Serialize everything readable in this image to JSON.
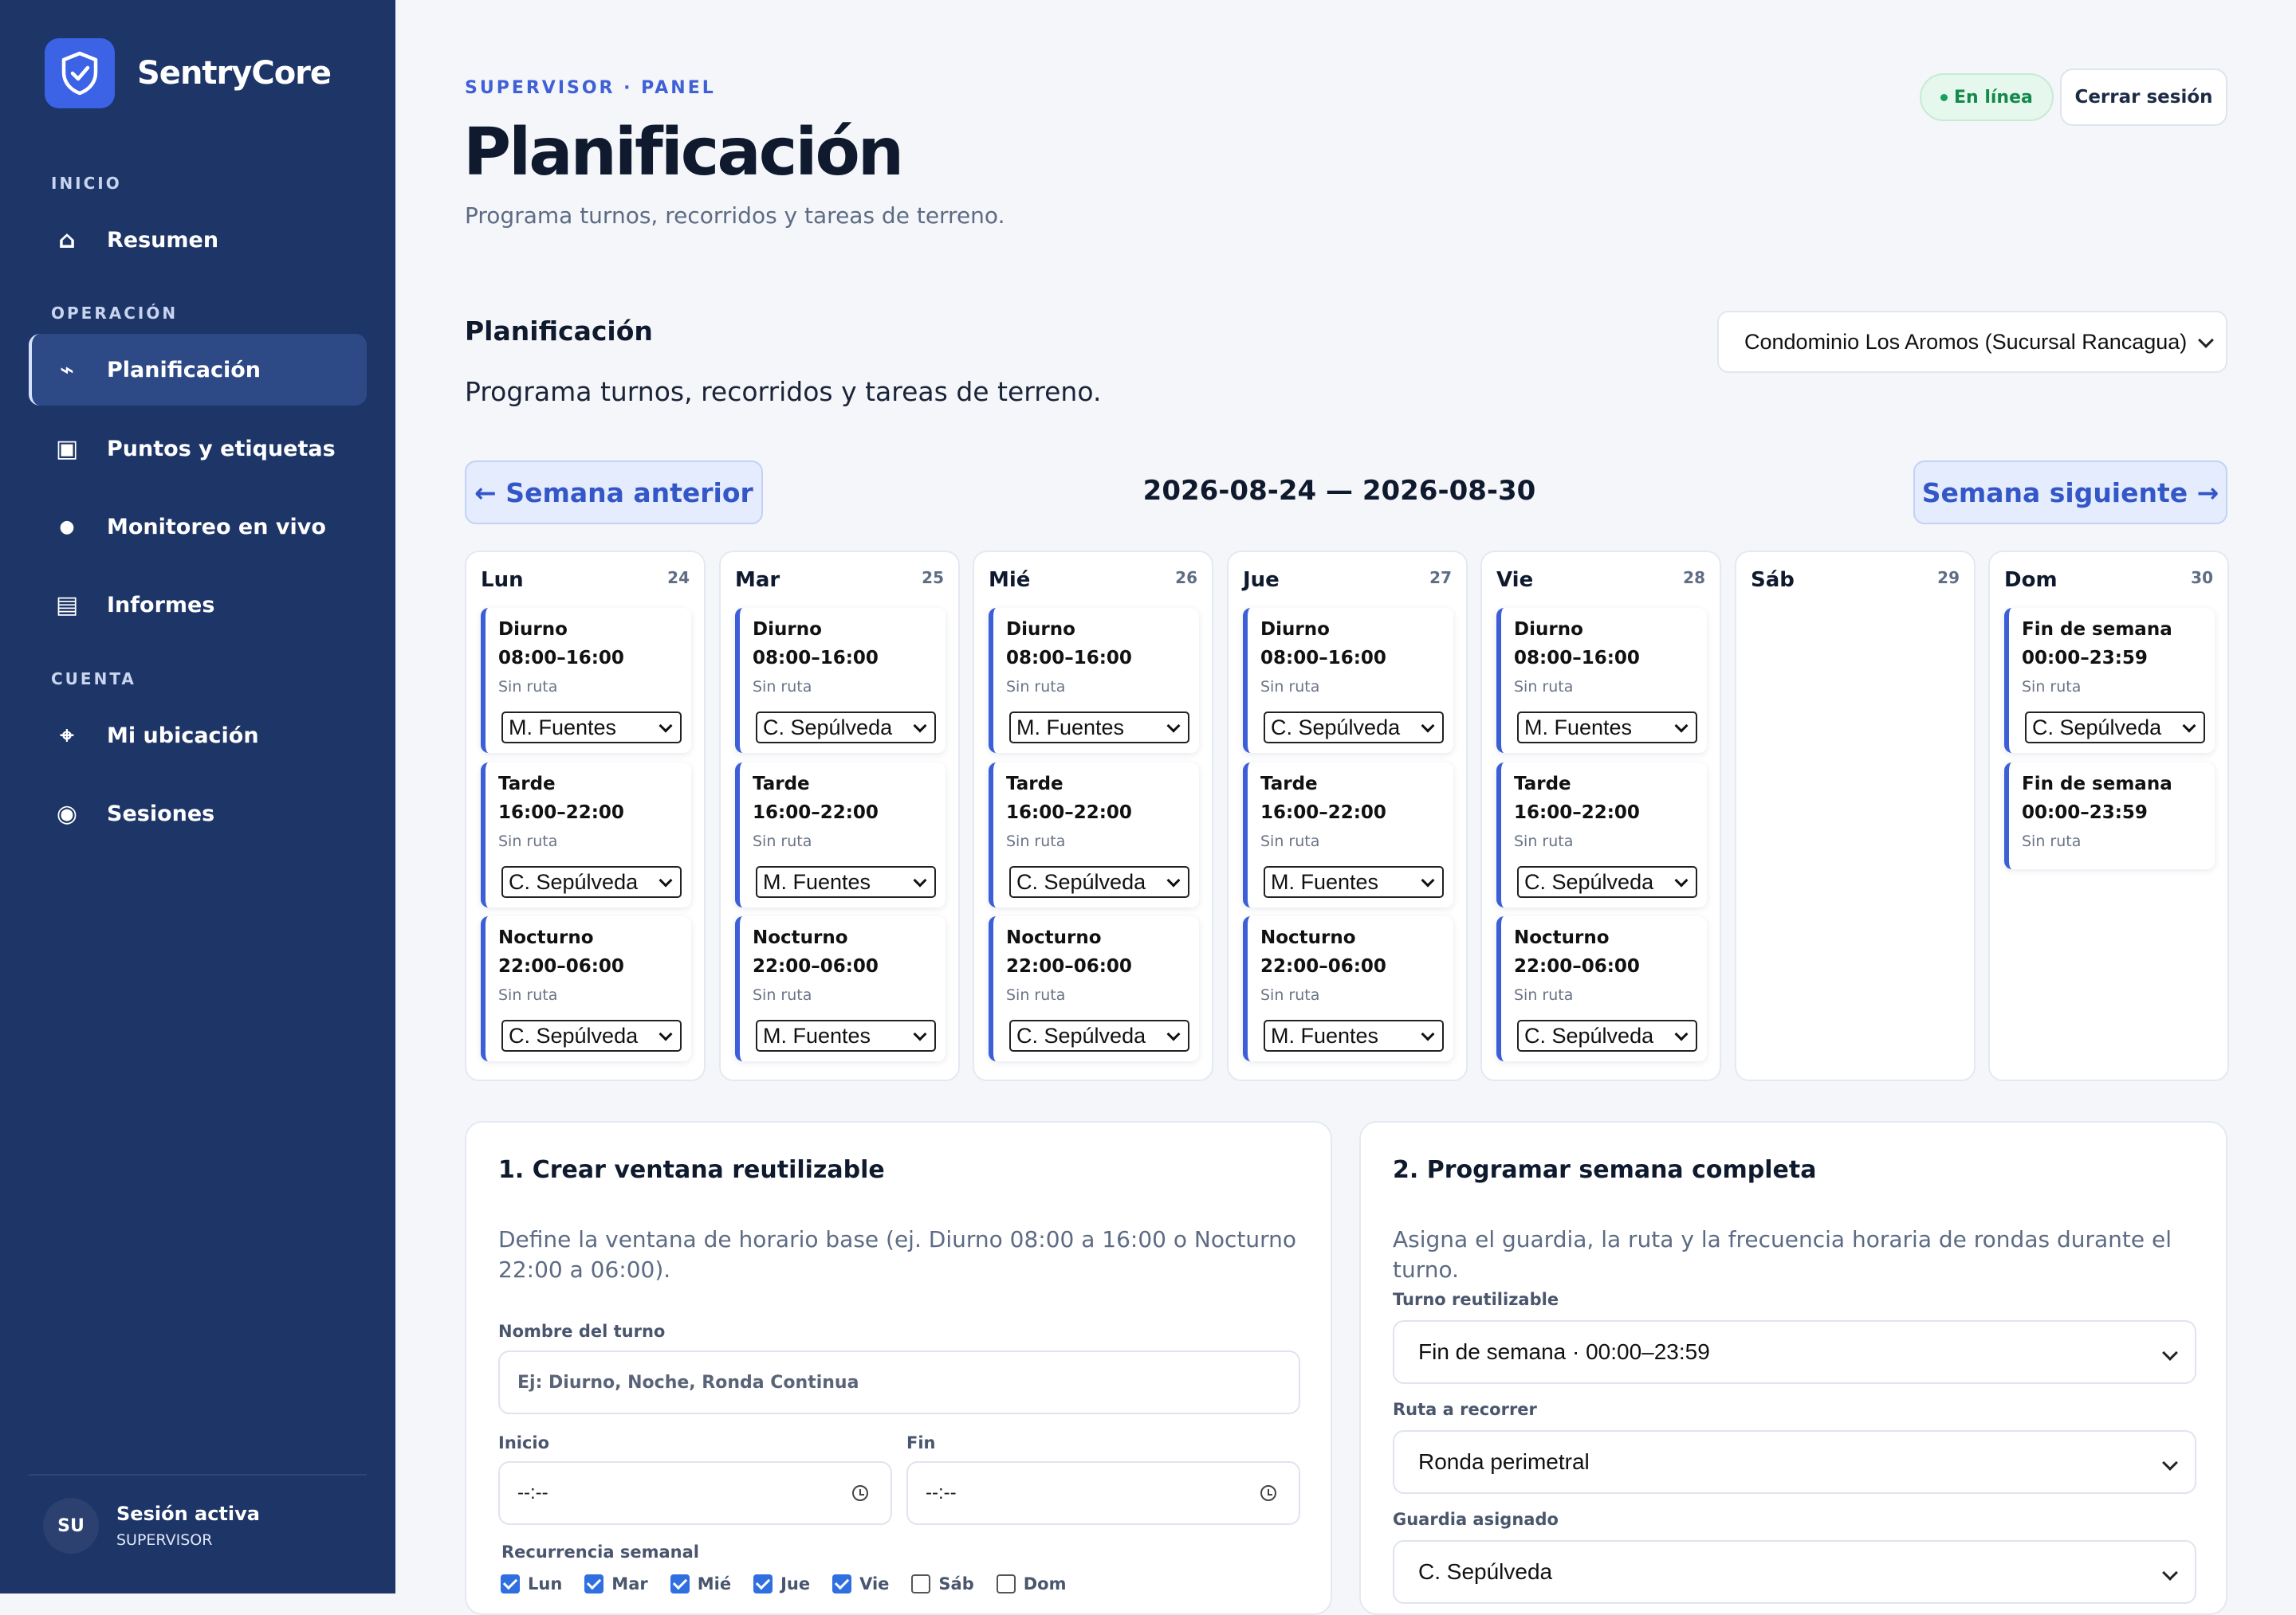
{
  "brand": {
    "name": "SentryCore"
  },
  "sidebar": {
    "sections": [
      "INICIO",
      "OPERACIÓN",
      "CUENTA"
    ],
    "items": [
      {
        "label": "Resumen",
        "icon": "home-icon",
        "active": false
      },
      {
        "label": "Planificación",
        "icon": "route-icon",
        "active": true
      },
      {
        "label": "Puntos y etiquetas",
        "icon": "tag-icon",
        "active": false
      },
      {
        "label": "Monitoreo en vivo",
        "icon": "live-dot-icon",
        "active": false
      },
      {
        "label": "Informes",
        "icon": "report-icon",
        "active": false
      },
      {
        "label": "Mi ubicación",
        "icon": "location-icon",
        "active": false
      },
      {
        "label": "Sesiones",
        "icon": "session-icon",
        "active": false
      }
    ],
    "user": {
      "initials": "SU",
      "name": "Sesión activa",
      "role": "SUPERVISOR"
    }
  },
  "header": {
    "eyebrow": "SUPERVISOR · PANEL",
    "title": "Planificación",
    "subtitle": "Programa turnos, recorridos y tareas de terreno.",
    "status": "En línea",
    "logout": "Cerrar sesión"
  },
  "section": {
    "title": "Planificación",
    "subtitle": "Programa turnos, recorridos y tareas de terreno.",
    "site": "Condominio Los Aromos (Sucursal Rancagua)"
  },
  "week": {
    "prev": "← Semana anterior",
    "next": "Semana siguiente →",
    "range": "2026-08-24 — 2026-08-30"
  },
  "days": [
    {
      "name": "Lun",
      "num": "24",
      "shifts": [
        {
          "name": "Diurno",
          "time": "08:00–16:00",
          "route": "Sin ruta",
          "guard": "M. Fuentes"
        },
        {
          "name": "Tarde",
          "time": "16:00–22:00",
          "route": "Sin ruta",
          "guard": "C. Sepúlveda"
        },
        {
          "name": "Nocturno",
          "time": "22:00–06:00",
          "route": "Sin ruta",
          "guard": "C. Sepúlveda"
        }
      ]
    },
    {
      "name": "Mar",
      "num": "25",
      "shifts": [
        {
          "name": "Diurno",
          "time": "08:00–16:00",
          "route": "Sin ruta",
          "guard": "C. Sepúlveda"
        },
        {
          "name": "Tarde",
          "time": "16:00–22:00",
          "route": "Sin ruta",
          "guard": "M. Fuentes"
        },
        {
          "name": "Nocturno",
          "time": "22:00–06:00",
          "route": "Sin ruta",
          "guard": "M. Fuentes"
        }
      ]
    },
    {
      "name": "Mié",
      "num": "26",
      "shifts": [
        {
          "name": "Diurno",
          "time": "08:00–16:00",
          "route": "Sin ruta",
          "guard": "M. Fuentes"
        },
        {
          "name": "Tarde",
          "time": "16:00–22:00",
          "route": "Sin ruta",
          "guard": "C. Sepúlveda"
        },
        {
          "name": "Nocturno",
          "time": "22:00–06:00",
          "route": "Sin ruta",
          "guard": "C. Sepúlveda"
        }
      ]
    },
    {
      "name": "Jue",
      "num": "27",
      "shifts": [
        {
          "name": "Diurno",
          "time": "08:00–16:00",
          "route": "Sin ruta",
          "guard": "C. Sepúlveda"
        },
        {
          "name": "Tarde",
          "time": "16:00–22:00",
          "route": "Sin ruta",
          "guard": "M. Fuentes"
        },
        {
          "name": "Nocturno",
          "time": "22:00–06:00",
          "route": "Sin ruta",
          "guard": "M. Fuentes"
        }
      ]
    },
    {
      "name": "Vie",
      "num": "28",
      "shifts": [
        {
          "name": "Diurno",
          "time": "08:00–16:00",
          "route": "Sin ruta",
          "guard": "M. Fuentes"
        },
        {
          "name": "Tarde",
          "time": "16:00–22:00",
          "route": "Sin ruta",
          "guard": "C. Sepúlveda"
        },
        {
          "name": "Nocturno",
          "time": "22:00–06:00",
          "route": "Sin ruta",
          "guard": "C. Sepúlveda"
        }
      ]
    },
    {
      "name": "Sáb",
      "num": "29",
      "shifts": []
    },
    {
      "name": "Dom",
      "num": "30",
      "shifts": [
        {
          "name": "Fin de semana",
          "time": "00:00–23:59",
          "route": "Sin ruta",
          "guard": "C. Sepúlveda"
        },
        {
          "name": "Fin de semana",
          "time": "00:00–23:59",
          "route": "Sin ruta",
          "guard": null
        }
      ]
    }
  ],
  "form1": {
    "title": "1. Crear ventana reutilizable",
    "subtitle": "Define la ventana de horario base (ej. Diurno 08:00 a 16:00 o Nocturno 22:00 a 06:00).",
    "name_label": "Nombre del turno",
    "name_placeholder": "Ej: Diurno, Noche, Ronda Continua",
    "start_label": "Inicio",
    "end_label": "Fin",
    "time_placeholder": "--:--",
    "recurrence_label": "Recurrencia semanal",
    "days": [
      {
        "label": "Lun",
        "checked": true
      },
      {
        "label": "Mar",
        "checked": true
      },
      {
        "label": "Mié",
        "checked": true
      },
      {
        "label": "Jue",
        "checked": true
      },
      {
        "label": "Vie",
        "checked": true
      },
      {
        "label": "Sáb",
        "checked": false
      },
      {
        "label": "Dom",
        "checked": false
      }
    ]
  },
  "form2": {
    "title": "2. Programar semana completa",
    "subtitle": "Asigna el guardia, la ruta y la frecuencia horaria de rondas durante el turno.",
    "shift_label": "Turno reutilizable",
    "shift_value": "Fin de semana · 00:00–23:59",
    "route_label": "Ruta a recorrer",
    "route_value": "Ronda perimetral",
    "guard_label": "Guardia asignado",
    "guard_value": "C. Sepúlveda"
  },
  "colors": {
    "sidebar": "#1d3567",
    "accent": "#3c62e6",
    "online": "#138a4a"
  }
}
